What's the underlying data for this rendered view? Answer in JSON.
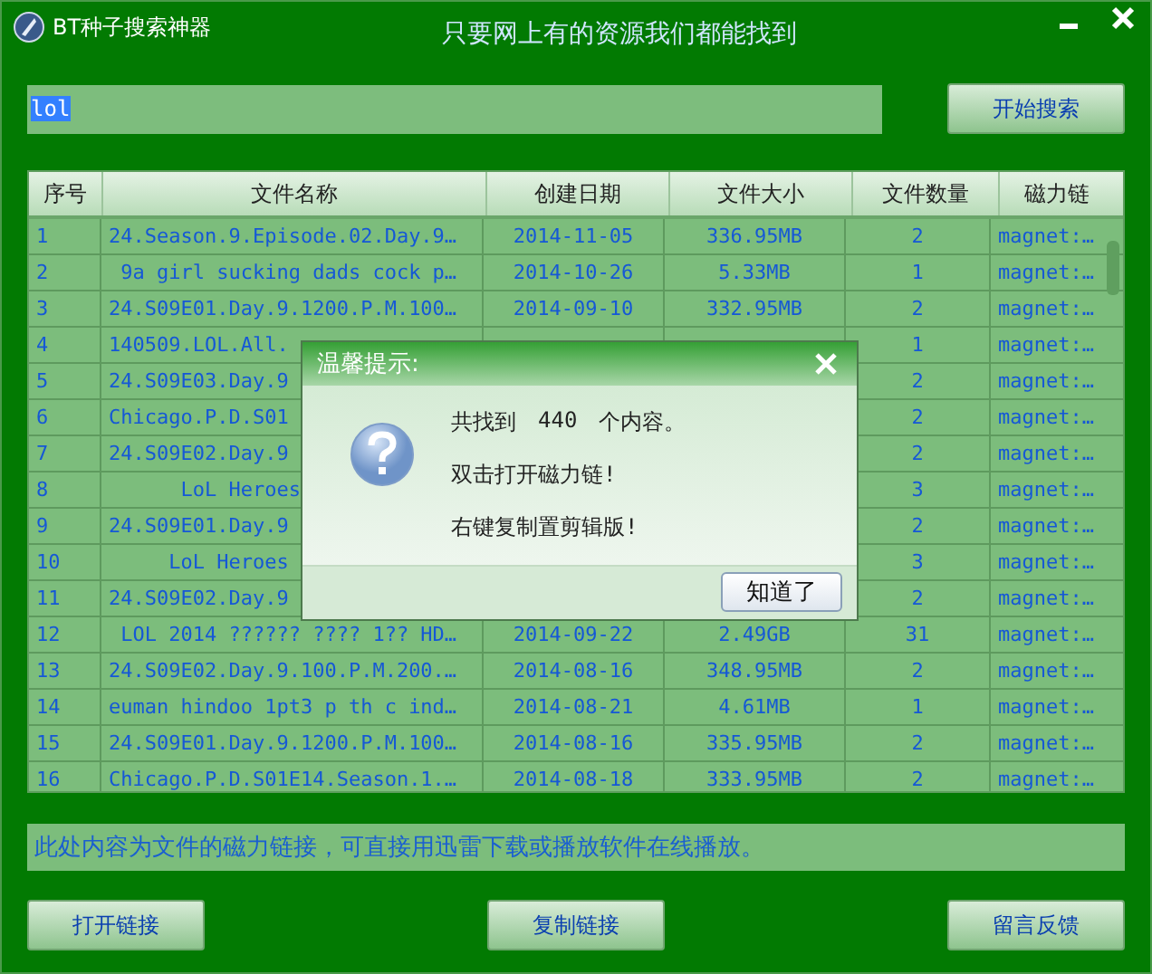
{
  "window": {
    "title": "BT种子搜索神器",
    "slogan": "只要网上有的资源我们都能找到"
  },
  "search": {
    "value": "lol",
    "text_selected": true,
    "button": "开始搜索"
  },
  "table": {
    "columns": [
      "序号",
      "文件名称",
      "创建日期",
      "文件大小",
      "文件数量",
      "磁力链"
    ],
    "rows": [
      {
        "no": "1",
        "name": "24.Season.9.Episode.02.Day.9…",
        "date": "2014-11-05",
        "size": "336.95MB",
        "count": "2",
        "link": "magnet:…"
      },
      {
        "no": "2",
        "name": " 9a girl sucking dads cock p…",
        "date": "2014-10-26",
        "size": "5.33MB",
        "count": "1",
        "link": "magnet:…"
      },
      {
        "no": "3",
        "name": "24.S09E01.Day.9.1200.P.M.100…",
        "date": "2014-09-10",
        "size": "332.95MB",
        "count": "2",
        "link": "magnet:…"
      },
      {
        "no": "4",
        "name": "140509.LOL.All.",
        "count": "1",
        "link": "magnet:…"
      },
      {
        "no": "5",
        "name": "24.S09E03.Day.9",
        "count": "2",
        "link": "magnet:…"
      },
      {
        "no": "6",
        "name": "Chicago.P.D.S01",
        "count": "2",
        "link": "magnet:…"
      },
      {
        "no": "7",
        "name": "24.S09E02.Day.9",
        "count": "2",
        "link": "magnet:…"
      },
      {
        "no": "8",
        "name": "      LoL Heroes",
        "count": "3",
        "link": "magnet:…"
      },
      {
        "no": "9",
        "name": "24.S09E01.Day.9",
        "count": "2",
        "link": "magnet:…"
      },
      {
        "no": "10",
        "name": "     LoL Heroes",
        "count": "3",
        "link": "magnet:…"
      },
      {
        "no": "11",
        "name": "24.S09E02.Day.9",
        "count": "2",
        "link": "magnet:…"
      },
      {
        "no": "12",
        "name": " LOL 2014 ?????? ???? 1?? HD…",
        "date": "2014-09-22",
        "size": "2.49GB",
        "count": "31",
        "link": "magnet:…"
      },
      {
        "no": "13",
        "name": "24.S09E02.Day.9.100.P.M.200.…",
        "date": "2014-08-16",
        "size": "348.95MB",
        "count": "2",
        "link": "magnet:…"
      },
      {
        "no": "14",
        "name": "euman hindoo 1pt3 p th c ind…",
        "date": "2014-08-21",
        "size": "4.61MB",
        "count": "1",
        "link": "magnet:…"
      },
      {
        "no": "15",
        "name": "24.S09E01.Day.9.1200.P.M.100…",
        "date": "2014-08-16",
        "size": "335.95MB",
        "count": "2",
        "link": "magnet:…"
      },
      {
        "no": "16",
        "name": "Chicago.P.D.S01E14.Season.1.…",
        "date": "2014-08-18",
        "size": "333.95MB",
        "count": "2",
        "link": "magnet:…"
      }
    ]
  },
  "info": "此处内容为文件的磁力链接，可直接用迅雷下载或播放软件在线播放。",
  "buttons": [
    "打开链接",
    "复制链接",
    "留言反馈"
  ],
  "dialog": {
    "title": "温馨提示:",
    "lines": [
      {
        "parts": [
          "共找到",
          "440",
          "个内容。"
        ]
      },
      {
        "parts": [
          "双击打开磁力链!"
        ]
      },
      {
        "parts": [
          "右键复制置剪辑版!"
        ]
      }
    ],
    "button": "知道了"
  }
}
